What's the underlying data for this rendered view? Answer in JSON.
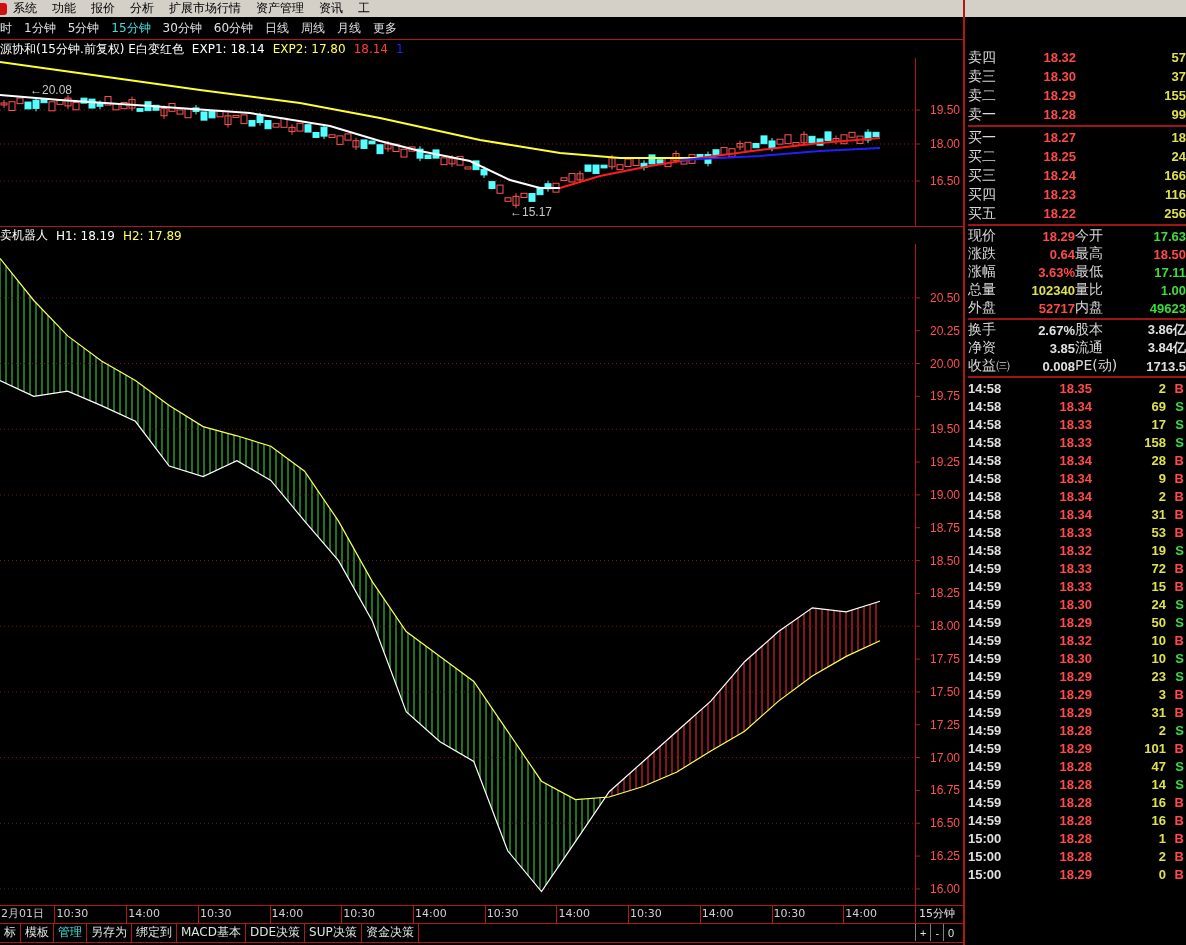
{
  "menu_bar": {
    "items": [
      "系统",
      "功能",
      "报价",
      "分析",
      "扩展市场行情",
      "资产管理",
      "资讯",
      "工"
    ]
  },
  "period_bar": {
    "items": [
      {
        "label": "时",
        "selected": false
      },
      {
        "label": "1分钟",
        "selected": false
      },
      {
        "label": "5分钟",
        "selected": false
      },
      {
        "label": "15分钟",
        "selected": true
      },
      {
        "label": "30分钟",
        "selected": false
      },
      {
        "label": "60分钟",
        "selected": false
      },
      {
        "label": "日线",
        "selected": false
      },
      {
        "label": "周线",
        "selected": false
      },
      {
        "label": "月线",
        "selected": false
      },
      {
        "label": "更多",
        "selected": false
      }
    ]
  },
  "main_chart": {
    "legend": [
      {
        "text": "源协和(15分钟.前复权) E白变红色",
        "color": "#ffffff"
      },
      {
        "text": "EXP1: 18.14",
        "color": "#ffffff"
      },
      {
        "text": "EXP2: 17.80",
        "color": "#ffff54"
      },
      {
        "text": "18.14",
        "color": "#ff3c3c"
      },
      {
        "text": "1",
        "color": "#2020ff"
      }
    ],
    "axis_labels": [
      "19.50",
      "18.00",
      "16.50"
    ],
    "high_note": "←20.08",
    "low_note": "←15.17"
  },
  "indicator": {
    "title": "卖机器人",
    "legend": [
      {
        "text": "H1: 18.19",
        "color": "#ffffff"
      },
      {
        "text": "H2: 17.89",
        "color": "#ffff54"
      }
    ],
    "chart_data": {
      "type": "line",
      "grid": true,
      "ylim": [
        15.87,
        20.91
      ],
      "yticks": [
        {
          "value": 16,
          "label": "16.00"
        },
        {
          "value": 16.25,
          "label": "16.25"
        },
        {
          "value": 16.5,
          "label": "16.50"
        },
        {
          "value": 16.75,
          "label": "16.75"
        },
        {
          "value": 17,
          "label": "17.00"
        },
        {
          "value": 17.25,
          "label": "17.25"
        },
        {
          "value": 17.5,
          "label": "17.50"
        },
        {
          "value": 17.75,
          "label": "17.75"
        },
        {
          "value": 18,
          "label": "18.00"
        },
        {
          "value": 18.25,
          "label": "18.25"
        },
        {
          "value": 18.5,
          "label": "18.50"
        },
        {
          "value": 18.75,
          "label": "18.75"
        },
        {
          "value": 19,
          "label": "19.00"
        },
        {
          "value": 19.25,
          "label": "19.25"
        },
        {
          "value": 19.5,
          "label": "19.50"
        },
        {
          "value": 19.75,
          "label": "19.75"
        },
        {
          "value": 20,
          "label": "20.00"
        },
        {
          "value": 20.25,
          "label": "20.25"
        },
        {
          "value": 20.5,
          "label": "20.50"
        }
      ],
      "series": [
        {
          "color": "#ffffff",
          "values": [
            19.87,
            19.75,
            19.79,
            19.68,
            19.56,
            19.22,
            19.14,
            19.26,
            19.11,
            18.8,
            18.5,
            18.04,
            17.35,
            17.12,
            16.97,
            16.29,
            15.98,
            16.36,
            16.74,
            16.97,
            17.2,
            17.43,
            17.73,
            17.96,
            18.14,
            18.11,
            18.19
          ]
        },
        {
          "color": "#ffff54",
          "values": [
            20.8,
            20.48,
            20.21,
            20.02,
            19.87,
            19.68,
            19.52,
            19.45,
            19.37,
            19.18,
            18.8,
            18.34,
            17.96,
            17.77,
            17.58,
            17.2,
            16.82,
            16.68,
            16.7,
            16.78,
            16.89,
            17.05,
            17.2,
            17.43,
            17.62,
            17.77,
            17.89
          ]
        }
      ]
    }
  },
  "time_axis": {
    "labels": [
      "2月01日",
      "10:30",
      "14:00",
      "10:30",
      "14:00",
      "10:30",
      "14:00",
      "10:30",
      "14:00",
      "10:30",
      "14:00",
      "10:30",
      "14:00"
    ],
    "period": "15分钟"
  },
  "bottom_tabs": {
    "items": [
      {
        "label": "标",
        "selected": false
      },
      {
        "label": "模板",
        "selected": false
      },
      {
        "label": "管理",
        "selected": true
      },
      {
        "label": "另存为",
        "selected": false
      },
      {
        "label": "绑定到",
        "selected": false
      },
      {
        "label": "MACD基本",
        "selected": false
      },
      {
        "label": "DDE决策",
        "selected": false
      },
      {
        "label": "SUP决策",
        "selected": false
      },
      {
        "label": "资金决策",
        "selected": false
      }
    ],
    "buttons": [
      "+",
      "-",
      "0"
    ]
  },
  "quote_panel": {
    "asks": [
      {
        "label": "卖四",
        "price": "18.32",
        "volume": "57"
      },
      {
        "label": "卖三",
        "price": "18.30",
        "volume": "37"
      },
      {
        "label": "卖二",
        "price": "18.29",
        "volume": "155"
      },
      {
        "label": "卖一",
        "price": "18.28",
        "volume": "99"
      }
    ],
    "bids": [
      {
        "label": "买一",
        "price": "18.27",
        "volume": "18"
      },
      {
        "label": "买二",
        "price": "18.25",
        "volume": "24"
      },
      {
        "label": "买三",
        "price": "18.24",
        "volume": "166"
      },
      {
        "label": "买四",
        "price": "18.23",
        "volume": "116"
      },
      {
        "label": "买五",
        "price": "18.22",
        "volume": "256"
      }
    ],
    "stats": [
      {
        "label": "现价",
        "value": "18.29",
        "color": "#ff4a4a"
      },
      {
        "label": "今开",
        "value": "17.63",
        "color": "#3cdc3c"
      },
      {
        "label": "涨跌",
        "value": "0.64",
        "color": "#ff4a4a"
      },
      {
        "label": "最高",
        "value": "18.50",
        "color": "#ff4a4a"
      },
      {
        "label": "涨幅",
        "value": "3.63%",
        "color": "#ff4a4a"
      },
      {
        "label": "最低",
        "value": "17.11",
        "color": "#3cdc3c"
      },
      {
        "label": "总量",
        "value": "102340",
        "color": "#e0e050"
      },
      {
        "label": "量比",
        "value": "1.00",
        "color": "#3cdc3c"
      },
      {
        "label": "外盘",
        "value": "52717",
        "color": "#ff4a4a"
      },
      {
        "label": "内盘",
        "value": "49623",
        "color": "#3cdc3c"
      }
    ],
    "fundamentals": [
      {
        "label": "换手",
        "value": "2.67%"
      },
      {
        "label": "股本",
        "value": "3.86亿"
      },
      {
        "label": "净资",
        "value": "3.85"
      },
      {
        "label": "流通",
        "value": "3.84亿"
      },
      {
        "label": "收益㈢",
        "value": "0.008"
      },
      {
        "label": "PE(动)",
        "value": "1713.5"
      }
    ],
    "trades": [
      {
        "time": "14:58",
        "price": "18.35",
        "volume": "2",
        "side": "B",
        "color": "#ff4a4a"
      },
      {
        "time": "14:58",
        "price": "18.34",
        "volume": "69",
        "side": "S",
        "color": "#3cdc3c"
      },
      {
        "time": "14:58",
        "price": "18.33",
        "volume": "17",
        "side": "S",
        "color": "#3cdc3c"
      },
      {
        "time": "14:58",
        "price": "18.33",
        "volume": "158",
        "side": "S",
        "color": "#3cdc3c"
      },
      {
        "time": "14:58",
        "price": "18.34",
        "volume": "28",
        "side": "B",
        "color": "#ff4a4a"
      },
      {
        "time": "14:58",
        "price": "18.34",
        "volume": "9",
        "side": "B",
        "color": "#ff4a4a"
      },
      {
        "time": "14:58",
        "price": "18.34",
        "volume": "2",
        "side": "B",
        "color": "#ff4a4a"
      },
      {
        "time": "14:58",
        "price": "18.34",
        "volume": "31",
        "side": "B",
        "color": "#ff4a4a"
      },
      {
        "time": "14:58",
        "price": "18.33",
        "volume": "53",
        "side": "B",
        "color": "#ff4a4a"
      },
      {
        "time": "14:58",
        "price": "18.32",
        "volume": "19",
        "side": "S",
        "color": "#3cdc3c"
      },
      {
        "time": "14:59",
        "price": "18.33",
        "volume": "72",
        "side": "B",
        "color": "#ff4a4a"
      },
      {
        "time": "14:59",
        "price": "18.33",
        "volume": "15",
        "side": "B",
        "color": "#ff4a4a"
      },
      {
        "time": "14:59",
        "price": "18.30",
        "volume": "24",
        "side": "S",
        "color": "#3cdc3c"
      },
      {
        "time": "14:59",
        "price": "18.29",
        "volume": "50",
        "side": "S",
        "color": "#3cdc3c"
      },
      {
        "time": "14:59",
        "price": "18.32",
        "volume": "10",
        "side": "B",
        "color": "#ff4a4a"
      },
      {
        "time": "14:59",
        "price": "18.30",
        "volume": "10",
        "side": "S",
        "color": "#3cdc3c"
      },
      {
        "time": "14:59",
        "price": "18.29",
        "volume": "23",
        "side": "S",
        "color": "#3cdc3c"
      },
      {
        "time": "14:59",
        "price": "18.29",
        "volume": "3",
        "side": "B",
        "color": "#ff4a4a"
      },
      {
        "time": "14:59",
        "price": "18.29",
        "volume": "31",
        "side": "B",
        "color": "#ff4a4a"
      },
      {
        "time": "14:59",
        "price": "18.28",
        "volume": "2",
        "side": "S",
        "color": "#3cdc3c"
      },
      {
        "time": "14:59",
        "price": "18.29",
        "volume": "101",
        "side": "B",
        "color": "#ff4a4a"
      },
      {
        "time": "14:59",
        "price": "18.28",
        "volume": "47",
        "side": "S",
        "color": "#3cdc3c"
      },
      {
        "time": "14:59",
        "price": "18.28",
        "volume": "14",
        "side": "S",
        "color": "#3cdc3c"
      },
      {
        "time": "14:59",
        "price": "18.28",
        "volume": "16",
        "side": "B",
        "color": "#ff4a4a"
      },
      {
        "time": "14:59",
        "price": "18.28",
        "volume": "16",
        "side": "B",
        "color": "#ff4a4a"
      },
      {
        "time": "15:00",
        "price": "18.28",
        "volume": "1",
        "side": "B",
        "color": "#ff4a4a"
      },
      {
        "time": "15:00",
        "price": "18.28",
        "volume": "2",
        "side": "B",
        "color": "#ff4a4a"
      },
      {
        "time": "15:00",
        "price": "18.29",
        "volume": "0",
        "side": "B",
        "color": "#ff4a4a"
      }
    ]
  }
}
